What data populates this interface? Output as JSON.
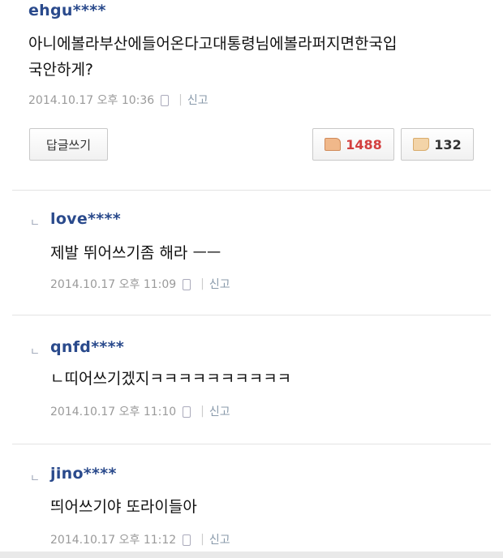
{
  "main_comment": {
    "username": "ehgu****",
    "text": "아니에볼라부산에들어온다고대통령님에볼라퍼지면한국입국안하게?",
    "text_line1": "아니에볼라부산에들어온다고대통령님에볼라퍼지면한국입",
    "text_line2": "국안하게?",
    "date": "2014.10.17 오후 10:36",
    "report": "신고",
    "reply_button": "답글쓰기",
    "likes": "1488",
    "dislikes": "132"
  },
  "replies": [
    {
      "mark": "ㄴ",
      "username": "love****",
      "text": "제발 뛰어쓰기좀 해라 ㅡㅡ",
      "date": "2014.10.17 오후 11:09",
      "report": "신고"
    },
    {
      "mark": "ㄴ",
      "username": "qnfd****",
      "text": "ㄴ띠어쓰기겠지ㅋㅋㅋㅋㅋㅋㅋㅋㅋㅋ",
      "date": "2014.10.17 오후 11:10",
      "report": "신고"
    },
    {
      "mark": "ㄴ",
      "username": "jino****",
      "text": "띄어쓰기야 또라이들아",
      "date": "2014.10.17 오후 11:12",
      "report": "신고"
    }
  ],
  "icons": {
    "mobile": "mobile-phone-icon",
    "like": "thumbs-up-icon",
    "dislike": "thumbs-down-icon"
  },
  "colors": {
    "username": "#2a4a8c",
    "likes": "#d33f3f"
  }
}
